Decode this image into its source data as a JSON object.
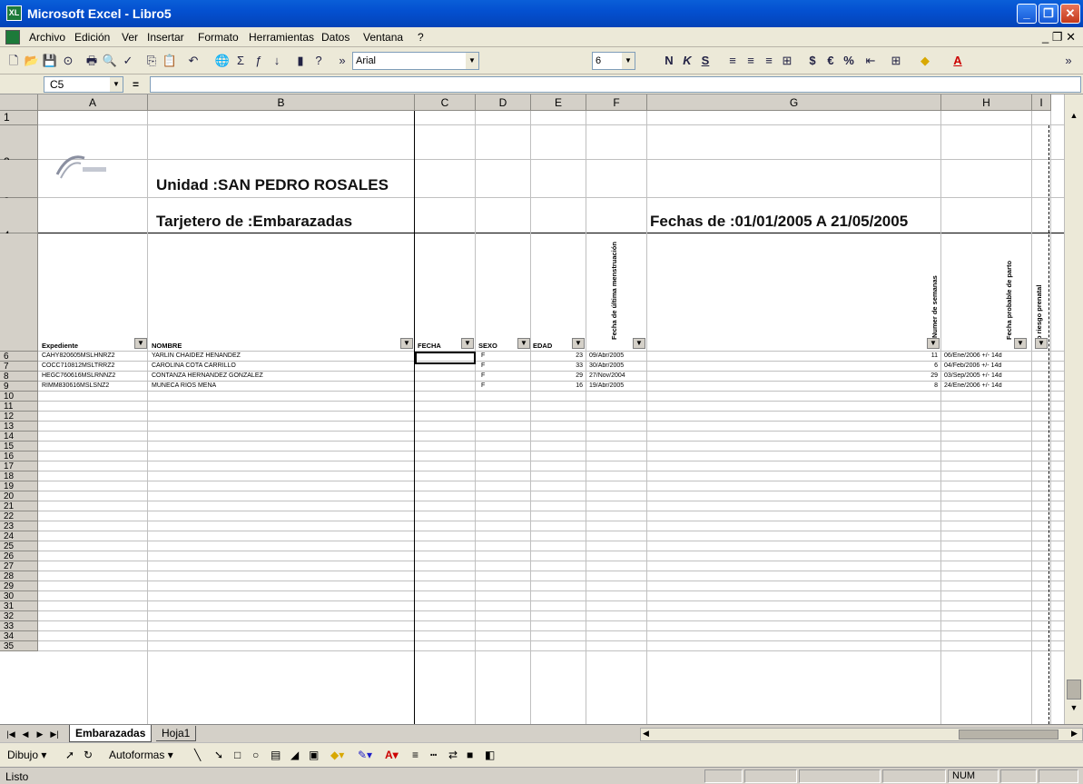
{
  "window": {
    "title": "Microsoft Excel - Libro5",
    "app_icon": "XL"
  },
  "menu": [
    "Archivo",
    "Edición",
    "Ver",
    "Insertar",
    "Formato",
    "Herramientas",
    "Datos",
    "Ventana",
    "?"
  ],
  "toolbar": {
    "font_name": "Arial",
    "font_size": "6",
    "bold": "N",
    "italic": "K",
    "underline": "S",
    "currency": "$",
    "euro": "€",
    "percent": "%"
  },
  "formula": {
    "cell_ref": "C5",
    "eq": "=",
    "value": ""
  },
  "columns": [
    "A",
    "B",
    "C",
    "D",
    "E",
    "F",
    "G",
    "H",
    "I"
  ],
  "rows": [
    "1",
    "2",
    "3",
    "4",
    "5",
    "6",
    "7",
    "8",
    "9",
    "10",
    "11",
    "12",
    "13",
    "14",
    "15",
    "16",
    "17",
    "18",
    "19",
    "20",
    "21",
    "22",
    "23",
    "24",
    "25",
    "26",
    "27",
    "28",
    "29",
    "30",
    "31",
    "32",
    "33",
    "34",
    "35"
  ],
  "sheet": {
    "unidad": "Unidad :SAN PEDRO ROSALES",
    "tarjetero": "Tarjetero de :Embarazadas",
    "fechas": "Fechas de :01/01/2005 A 21/05/2005",
    "headers": {
      "expediente": "Expediente",
      "nombre": "NOMBRE",
      "fecha": "FECHA",
      "sexo": "SEXO",
      "edad": "EDAD",
      "fum": "Fecha de última menstruación",
      "semanas": "Numer de semanas",
      "fpp": "Fecha probable de parto",
      "riesgo": "o riesgo prenatal"
    },
    "records": [
      {
        "exp": "CAHY820605MSLHNRZ2",
        "nombre": "YARLIN CHAIDEZ HENANDEZ",
        "sexo": "F",
        "edad": "23",
        "fum": "09/Abr/2005",
        "sem": "11",
        "fpp": "06/Ene/2006 +/- 14d"
      },
      {
        "exp": "COCC710812MSLTRRZ2",
        "nombre": "CAROLINA COTA CARRILLO",
        "sexo": "F",
        "edad": "33",
        "fum": "30/Abr/2005",
        "sem": "6",
        "fpp": "04/Feb/2006 +/- 14d"
      },
      {
        "exp": "HEGC760616MSLRNNZ2",
        "nombre": "CONTANZA HERNANDEZ GONZALEZ",
        "sexo": "F",
        "edad": "29",
        "fum": "27/Nov/2004",
        "sem": "29",
        "fpp": "03/Sep/2005 +/- 14d"
      },
      {
        "exp": "RIMM830616MSLSÑZ2",
        "nombre": "MUÑECA RIOS MENA",
        "sexo": "F",
        "edad": "16",
        "fum": "19/Abr/2005",
        "sem": "8",
        "fpp": "24/Ene/2006 +/- 14d"
      }
    ]
  },
  "tabs": {
    "active": "Embarazadas",
    "other": "Hoja1"
  },
  "drawbar": {
    "dibujo": "Dibujo",
    "autoformas": "Autoformas"
  },
  "status": {
    "left": "Listo",
    "num": "NUM"
  }
}
